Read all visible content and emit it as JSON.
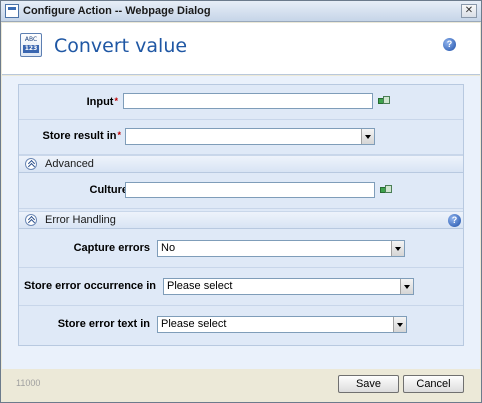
{
  "window": {
    "title": "Configure Action -- Webpage Dialog",
    "close_glyph": "✕"
  },
  "header": {
    "icon_top": "ABC",
    "icon_bottom": "123",
    "heading": "Convert value",
    "help_glyph": "?"
  },
  "form": {
    "input": {
      "label": "Input",
      "required_mark": "*",
      "value": ""
    },
    "store_result": {
      "label": "Store result in",
      "required_mark": "*",
      "value": ""
    },
    "advanced": {
      "label": "Advanced"
    },
    "culture": {
      "label": "Culture",
      "value": ""
    },
    "error_handling": {
      "label": "Error Handling",
      "help_glyph": "?"
    },
    "capture_errors": {
      "label": "Capture errors",
      "value": "No"
    },
    "store_error_occurrence": {
      "label": "Store error occurrence in",
      "value": "Please select"
    },
    "store_error_text": {
      "label": "Store error text in",
      "value": "Please select"
    }
  },
  "footer": {
    "code": "11000",
    "save_label": "Save",
    "cancel_label": "Cancel"
  },
  "colors": {
    "heading": "#1f57a4",
    "required": "#c00000",
    "panel": "#dfe9f7"
  }
}
